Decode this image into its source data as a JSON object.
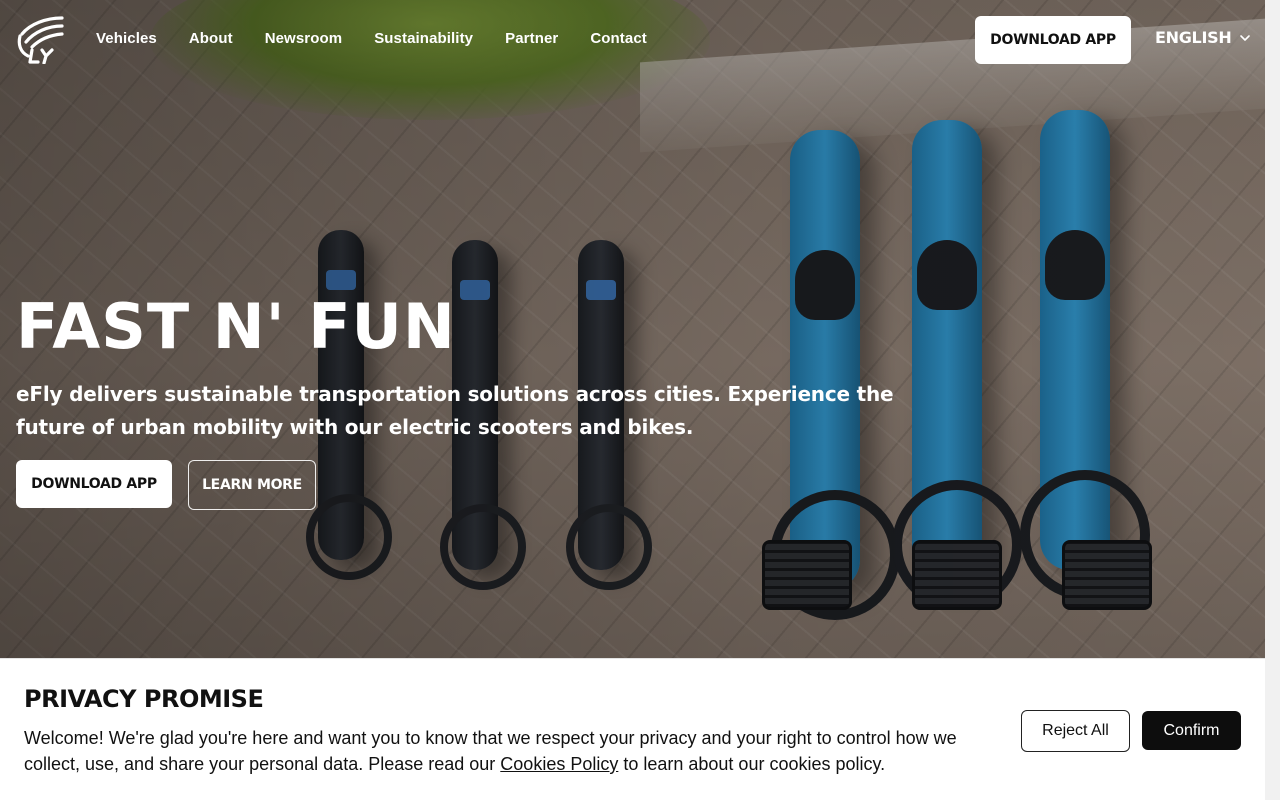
{
  "nav": {
    "logo_icon": "efly-wing-logo-icon",
    "links": [
      "Vehicles",
      "About",
      "Newsroom",
      "Sustainability",
      "Partner",
      "Contact"
    ],
    "download_label": "DOWNLOAD APP",
    "language_label": "ENGLISH",
    "language_icon": "chevron-down-icon"
  },
  "hero": {
    "title": "FAST N' FUN",
    "subtitle": "eFly delivers sustainable transportation solutions across cities. Experience the future of urban mobility with our electric scooters and bikes.",
    "primary_button": "DOWNLOAD APP",
    "secondary_button": "LEARN MORE"
  },
  "cookie_banner": {
    "title": "PRIVACY PROMISE",
    "text_before_link": "Welcome! We're glad you're here and want you to know that we respect your privacy and your right to control how we collect, use, and share your personal data. Please read our ",
    "link_label": "Cookies Policy",
    "text_after_link": " to learn about our cookies policy.",
    "reject_label": "Reject All",
    "confirm_label": "Confirm"
  },
  "colors": {
    "primary_button_bg": "#ffffff",
    "confirm_button_bg": "#0d0d0d",
    "bike_accent": "#2f8fc2"
  }
}
